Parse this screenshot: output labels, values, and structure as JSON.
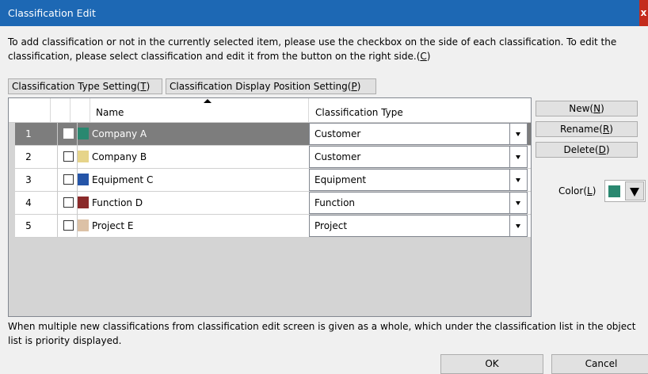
{
  "window": {
    "title": "Classification Edit",
    "close_label": "x"
  },
  "description": {
    "text": "To add classification or not in the currently selected item, please use the checkbox on the side of each classification. To edit the classification, please select classification and edit it from the button on the right side.(",
    "hotkey": "C",
    "close": ")"
  },
  "top_buttons": {
    "type_setting": {
      "label": "Classification Type Setting(",
      "hotkey": "T",
      "close": ")"
    },
    "display_position": {
      "label": "Classification Display Position Setting(",
      "hotkey": "P",
      "close": ")"
    }
  },
  "grid": {
    "columns": {
      "name": "Name",
      "type": "Classification Type"
    },
    "rows": [
      {
        "num": "1",
        "name": "Company A",
        "color": "#2a8870",
        "type": "Customer",
        "selected": true
      },
      {
        "num": "2",
        "name": "Company B",
        "color": "#e6d48a",
        "type": "Customer",
        "selected": false
      },
      {
        "num": "3",
        "name": "Equipment C",
        "color": "#2555a8",
        "type": "Equipment",
        "selected": false
      },
      {
        "num": "4",
        "name": "Function D",
        "color": "#8b2a2a",
        "type": "Function",
        "selected": false
      },
      {
        "num": "5",
        "name": "Project E",
        "color": "#dcc1a6",
        "type": "Project",
        "selected": false
      }
    ]
  },
  "side_buttons": {
    "new": {
      "label": "New(",
      "hotkey": "N",
      "close": ")"
    },
    "rename": {
      "label": "Rename(",
      "hotkey": "R",
      "close": ")"
    },
    "delete": {
      "label": "Delete(",
      "hotkey": "D",
      "close": ")"
    },
    "color": {
      "label": "Color(",
      "hotkey": "L",
      "close": ")",
      "value": "#2a8870"
    }
  },
  "note": "When multiple new classifications from classification edit screen is given as a whole, which under the classification list in the object list is priority displayed.",
  "footer": {
    "ok": "OK",
    "cancel": "Cancel"
  }
}
